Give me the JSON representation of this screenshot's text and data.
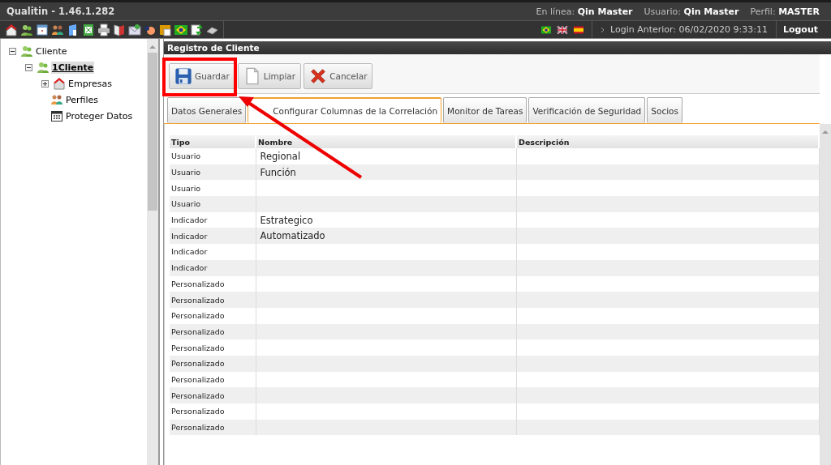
{
  "window": {
    "title": "Qualitin - 1.46.1.282"
  },
  "session": {
    "online_label": "En línea:",
    "online_user": "Qin Master",
    "user_label": "Usuario:",
    "user": "Qin Master",
    "profile_label": "Perfil:",
    "profile": "MASTER",
    "last_login": "Login Anterior: 06/02/2020 9:33:11",
    "logout": "Logout"
  },
  "tree": [
    {
      "label": "Cliente",
      "expanded": true,
      "selected": false,
      "children": [
        {
          "label": "1Cliente",
          "expanded": true,
          "selected": true,
          "children": [
            {
              "label": "Empresas",
              "expanded": false,
              "selected": false,
              "kind": "company"
            },
            {
              "label": "Perfiles",
              "selected": false,
              "kind": "profiles"
            },
            {
              "label": "Proteger Datos",
              "selected": false,
              "kind": "calendar"
            }
          ]
        }
      ]
    }
  ],
  "panel": {
    "title": "Registro de Cliente"
  },
  "buttons": [
    {
      "label": "Guardar",
      "kind": "save",
      "disabled": false
    },
    {
      "label": "Limpiar",
      "kind": "clear",
      "disabled": false
    },
    {
      "label": "Cancelar",
      "kind": "cancel",
      "disabled": false
    }
  ],
  "tabs": [
    {
      "label": "Datos Generales",
      "selected": false
    },
    {
      "label": "Configurar Columnas de la Correlación",
      "selected": true
    },
    {
      "label": "Monitor de Tareas",
      "selected": false
    },
    {
      "label": "Verificación de Seguridad",
      "selected": false
    },
    {
      "label": "Socios",
      "selected": false
    }
  ],
  "table": {
    "columns": [
      "Tipo",
      "Nombre",
      "Descripción"
    ],
    "rows": [
      [
        "Usuario",
        "Regional"
      ],
      [
        "Usuario",
        "Función"
      ],
      [
        "Usuario"
      ],
      [
        "Usuario"
      ],
      [
        "Indicador",
        "Estrategico"
      ],
      [
        "Indicador",
        "Automatizado"
      ],
      [
        "Indicador"
      ],
      [
        "Indicador"
      ],
      [
        "Personalizado"
      ],
      [
        "Personalizado"
      ],
      [
        "Personalizado"
      ],
      [
        "Personalizado"
      ],
      [
        "Personalizado"
      ],
      [
        "Personalizado"
      ],
      [
        "Personalizado"
      ],
      [
        "Personalizado"
      ],
      [
        "Personalizado"
      ],
      [
        "Personalizado"
      ]
    ]
  },
  "annotation": {
    "highlight_box": true,
    "arrow": true
  }
}
